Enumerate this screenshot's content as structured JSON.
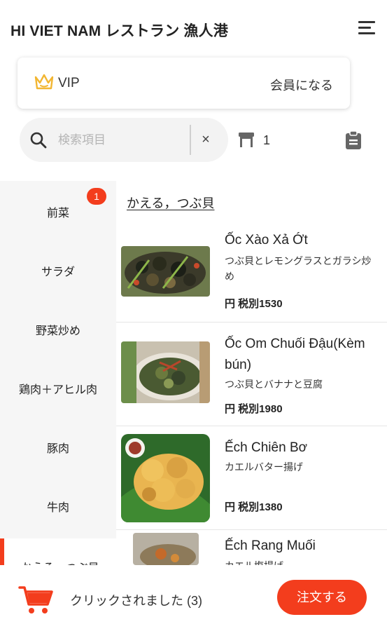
{
  "header": {
    "title": "HI VIET NAM レストラン 漁人港"
  },
  "vip": {
    "label": "VIP",
    "join_label": "会員になる"
  },
  "search": {
    "placeholder": "検索項目",
    "clear_label": "×"
  },
  "table": {
    "number": "1"
  },
  "categories": {
    "items": [
      {
        "label": "前菜",
        "badge": "1"
      },
      {
        "label": "サラダ"
      },
      {
        "label": "野菜炒め"
      },
      {
        "label": "鶏肉＋アヒル肉"
      },
      {
        "label": "豚肉"
      },
      {
        "label": "牛肉"
      }
    ],
    "active_label": "かえる，つぶ貝"
  },
  "section": {
    "title": "かえる，つぶ貝"
  },
  "menu_items": [
    {
      "name": "Ốc Xào Xả Ớt",
      "desc": "つぶ貝とレモングラスとガラシ炒め",
      "price": "円 税別1530"
    },
    {
      "name": "Ốc Om Chuối Đậu(Kèm bún)",
      "desc": "つぶ貝とバナナと豆腐",
      "price": "円 税別1980"
    },
    {
      "name": "Ếch Chiên Bơ",
      "desc": "カエルバター揚げ",
      "price": "円 税別1380"
    },
    {
      "name": "Ếch Rang Muối",
      "desc": "カエル塩揚げ",
      "price": ""
    }
  ],
  "cart": {
    "clicked_text": "クリックされました (3)",
    "order_label": "注文する"
  },
  "colors": {
    "accent": "#f33d1d",
    "sidebar_bg": "#f6f6f6",
    "crown": "#f2b632"
  }
}
